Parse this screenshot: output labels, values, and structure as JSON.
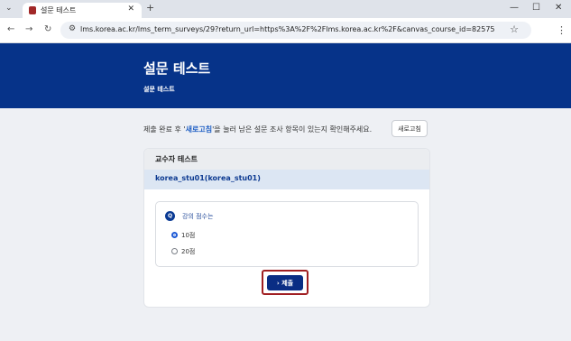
{
  "browser": {
    "tab_title": "설문 테스트",
    "tab_close": "✕",
    "new_tab": "+",
    "url": "lms.korea.ac.kr/lms_term_surveys/29?return_url=https%3A%2F%2Flms.korea.ac.kr%2F&canvas_course_id=82575"
  },
  "header": {
    "title": "설문 테스트",
    "subtitle": "설문 테스트"
  },
  "notice": {
    "before": "제출 완료 후 '",
    "highlight": "새로고침",
    "after": "'을 눌러 남은 설문 조사 항목이 있는지 확인해주세요.",
    "refresh_label": "새로고침"
  },
  "card": {
    "header": "교수자 테스트",
    "user": "korea_stu01(korea_stu01)",
    "question": {
      "badge": "Q",
      "text": "강의 점수는",
      "options": [
        {
          "label": "10점",
          "selected": true
        },
        {
          "label": "20점",
          "selected": false
        }
      ]
    },
    "submit_label": "› 제출"
  },
  "colors": {
    "brand": "#063389",
    "highlight_frame": "#a01f22"
  }
}
